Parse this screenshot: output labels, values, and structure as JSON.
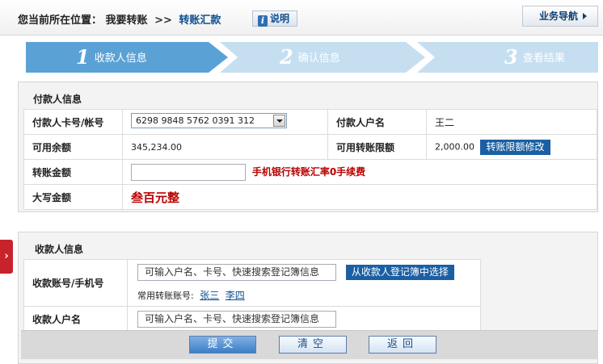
{
  "header": {
    "location_label": "您当前所在位置：",
    "crumb_parent": "我要转账",
    "crumb_sep": ">>",
    "crumb_current": "转账汇款",
    "help_label": "说明",
    "biz_nav_label": "业务导航"
  },
  "steps": [
    {
      "num": "1",
      "label": "收款人信息",
      "active": true
    },
    {
      "num": "2",
      "label": "确认信息",
      "active": false
    },
    {
      "num": "3",
      "label": "查看结果",
      "active": false
    }
  ],
  "payer": {
    "title": "付款人信息",
    "card_label": "付款人卡号/帐号",
    "card_value": "6298 9848 5762 0391 312",
    "name_label": "付款人户名",
    "name_value": "王二",
    "balance_label": "可用余额",
    "balance_value": "345,234.00",
    "limit_label": "可用转账限额",
    "limit_value": "2,000.00",
    "limit_edit_button": "转账限额修改",
    "amount_label": "转账金额",
    "amount_value": "",
    "fee_note": "手机银行转账汇率0手续费",
    "capital_label": "大写金额",
    "capital_value": "叁百元整"
  },
  "sidetab": {
    "arrow": "›"
  },
  "payee": {
    "title": "收款人信息",
    "account_label": "收款账号/手机号",
    "account_placeholder": "可输入户名、卡号、快速搜索登记簿信息",
    "registry_button": "从收款人登记簿中选择",
    "recent_label": "常用转账账号:",
    "recent_contacts": [
      "张三",
      "李四"
    ],
    "name_label": "收款人户名",
    "name_placeholder": "可输入户名、卡号、快速搜索登记簿信息"
  },
  "actions": {
    "submit": "提交",
    "clear": "清空",
    "back": "返回"
  },
  "colors": {
    "accent": "#1b5fa3",
    "step_active": "#5aa2d6",
    "step_inactive": "#c5dff1",
    "warning_text": "#b80000",
    "side_tab": "#c8232c"
  }
}
